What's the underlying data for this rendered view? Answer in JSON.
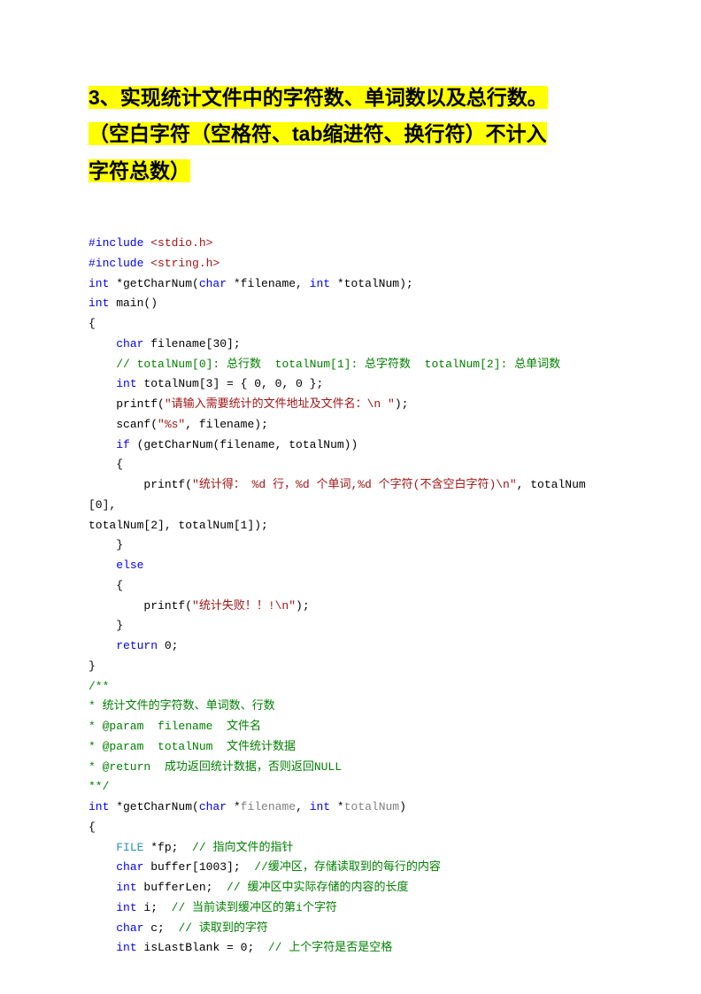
{
  "title_part1": "3、实现统计文件中的字符数、单词数以及总行数。",
  "title_part2": "（空白字符（空格符、tab缩进符、换行符）不计入",
  "title_part3": "字符总数）",
  "code": {
    "l1_a": "#include",
    "l1_b": " <stdio.h>",
    "l2_a": "#include",
    "l2_b": " <string.h>",
    "l3_a": "int",
    "l3_b": " *getCharNum(",
    "l3_c": "char",
    "l3_d": " *filename, ",
    "l3_e": "int",
    "l3_f": " *totalNum);",
    "l4_a": "int",
    "l4_b": " main()",
    "l5": "{",
    "l6_a": "    ",
    "l6_b": "char",
    "l6_c": " filename[30];",
    "l7_a": "    ",
    "l7_b": "// totalNum[0]: 总行数  totalNum[1]: 总字符数  totalNum[2]: 总单词数",
    "l8_a": "    ",
    "l8_b": "int",
    "l8_c": " totalNum[3] = { 0, 0, 0 };",
    "l9_a": "    printf(",
    "l9_b": "\"请输入需要统计的文件地址及文件名：\\n \"",
    "l9_c": ");",
    "l10_a": "    scanf(",
    "l10_b": "\"%s\"",
    "l10_c": ", filename);",
    "l11_a": "    ",
    "l11_b": "if",
    "l11_c": " (getCharNum(filename, totalNum))",
    "l12": "    {",
    "l13_a": "        printf(",
    "l13_b": "\"统计得： %d 行，%d 个单词,%d 个字符(不含空白字符)\\n\"",
    "l13_c": ", totalNum[0], ",
    "l14": "totalNum[2], totalNum[1]);",
    "l15": "    }",
    "l16_a": "    ",
    "l16_b": "else",
    "l17": "    {",
    "l18_a": "        printf(",
    "l18_b": "\"统计失败！！!\\n\"",
    "l18_c": ");",
    "l19": "    }",
    "l20_a": "    ",
    "l20_b": "return",
    "l20_c": " 0;",
    "l21": "}",
    "l22": "/**",
    "l23": "* 统计文件的字符数、单词数、行数",
    "l24": "* @param  filename  文件名",
    "l25": "* @param  totalNum  文件统计数据",
    "l26": "* @return  成功返回统计数据，否则返回NULL",
    "l27": "**/",
    "l28_a": "int",
    "l28_b": " *getCharNum(",
    "l28_c": "char",
    "l28_d": " *",
    "l28_e": "filename",
    "l28_f": ", ",
    "l28_g": "int",
    "l28_h": " *",
    "l28_i": "totalNum",
    "l28_j": ")",
    "l29": "{",
    "l30_a": "    ",
    "l30_b": "FILE",
    "l30_c": " *fp;  ",
    "l30_d": "// 指向文件的指针",
    "l31_a": "    ",
    "l31_b": "char",
    "l31_c": " buffer[1003];  ",
    "l31_d": "//缓冲区，存储读取到的每行的内容",
    "l32_a": "    ",
    "l32_b": "int",
    "l32_c": " bufferLen;  ",
    "l32_d": "// 缓冲区中实际存储的内容的长度",
    "l33_a": "    ",
    "l33_b": "int",
    "l33_c": " i;  ",
    "l33_d": "// 当前读到缓冲区的第i个字符",
    "l34_a": "    ",
    "l34_b": "char",
    "l34_c": " c;  ",
    "l34_d": "// 读取到的字符",
    "l35_a": "    ",
    "l35_b": "int",
    "l35_c": " isLastBlank = 0;  ",
    "l35_d": "// 上个字符是否是空格"
  }
}
